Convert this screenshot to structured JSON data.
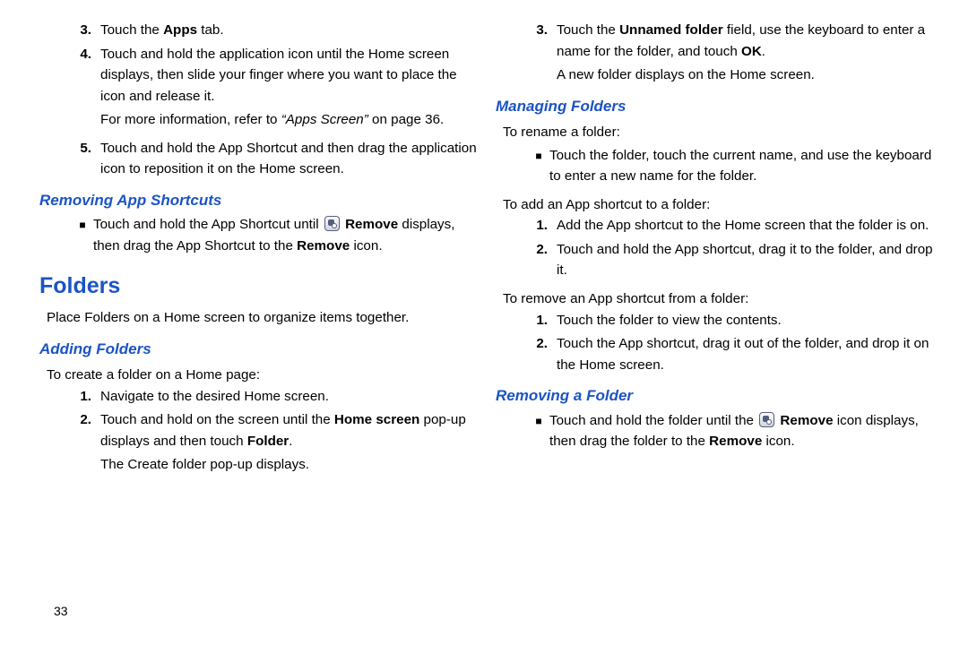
{
  "left": {
    "step3": {
      "n": "3.",
      "a": "Touch the ",
      "b": "Apps",
      "c": " tab."
    },
    "step4": {
      "n": "4.",
      "txt": "Touch and hold the application icon until the Home screen displays, then slide your finger where you want to place the icon and release it."
    },
    "step4b": {
      "a": "For more information, refer to ",
      "b": "“Apps Screen”",
      "c": " on page 36."
    },
    "step5": {
      "n": "5.",
      "txt": "Touch and hold the App Shortcut and then drag the application icon to reposition it on the Home screen."
    },
    "removeHdr": "Removing App Shortcuts",
    "removeBul": {
      "a": "Touch and hold the App Shortcut until ",
      "b": " Remove",
      "c": " displays, then drag the App Shortcut to the ",
      "d": "Remove",
      "e": " icon."
    },
    "foldersHdr": "Folders",
    "foldersIntro": "Place Folders on a Home screen to organize items together.",
    "addHdr": "Adding Folders",
    "addIntro": "To create a folder on a Home page:",
    "add1": {
      "n": "1.",
      "txt": "Navigate to the desired Home screen."
    },
    "add2": {
      "n": "2.",
      "a": "Touch and hold on the screen until the ",
      "b": "Home screen",
      "c": " pop-up displays and then touch ",
      "d": "Folder",
      "e": "."
    },
    "add2b": "The Create folder pop-up displays.",
    "pagenum": "33"
  },
  "right": {
    "step3": {
      "n": "3.",
      "a": "Touch the ",
      "b": "Unnamed folder",
      "c": " field, use the keyboard to enter a name for the folder, and touch ",
      "d": "OK",
      "e": "."
    },
    "step3b": "A new folder displays on the Home screen.",
    "manageHdr": "Managing Folders",
    "renameIntro": "To rename a folder:",
    "renameBul": "Touch the folder, touch the current name, and use the keyboard to enter a new name for the folder.",
    "addShortIntro": "To add an App shortcut to a folder:",
    "addS1": {
      "n": "1.",
      "txt": "Add the App shortcut to the Home screen that the folder is on."
    },
    "addS2": {
      "n": "2.",
      "txt": "Touch and hold the App shortcut, drag it to the folder, and drop it."
    },
    "remShortIntro": "To remove an App shortcut from a folder:",
    "remS1": {
      "n": "1.",
      "txt": "Touch the folder to view the contents."
    },
    "remS2": {
      "n": "2.",
      "txt": "Touch the App shortcut, drag it out of the folder, and drop it on the Home screen."
    },
    "removeFolderHdr": "Removing a Folder",
    "removeFolderBul": {
      "a": "Touch and hold the folder until the ",
      "b": " Remove",
      "c": " icon displays, then drag the folder to the ",
      "d": "Remove",
      "e": " icon."
    }
  }
}
